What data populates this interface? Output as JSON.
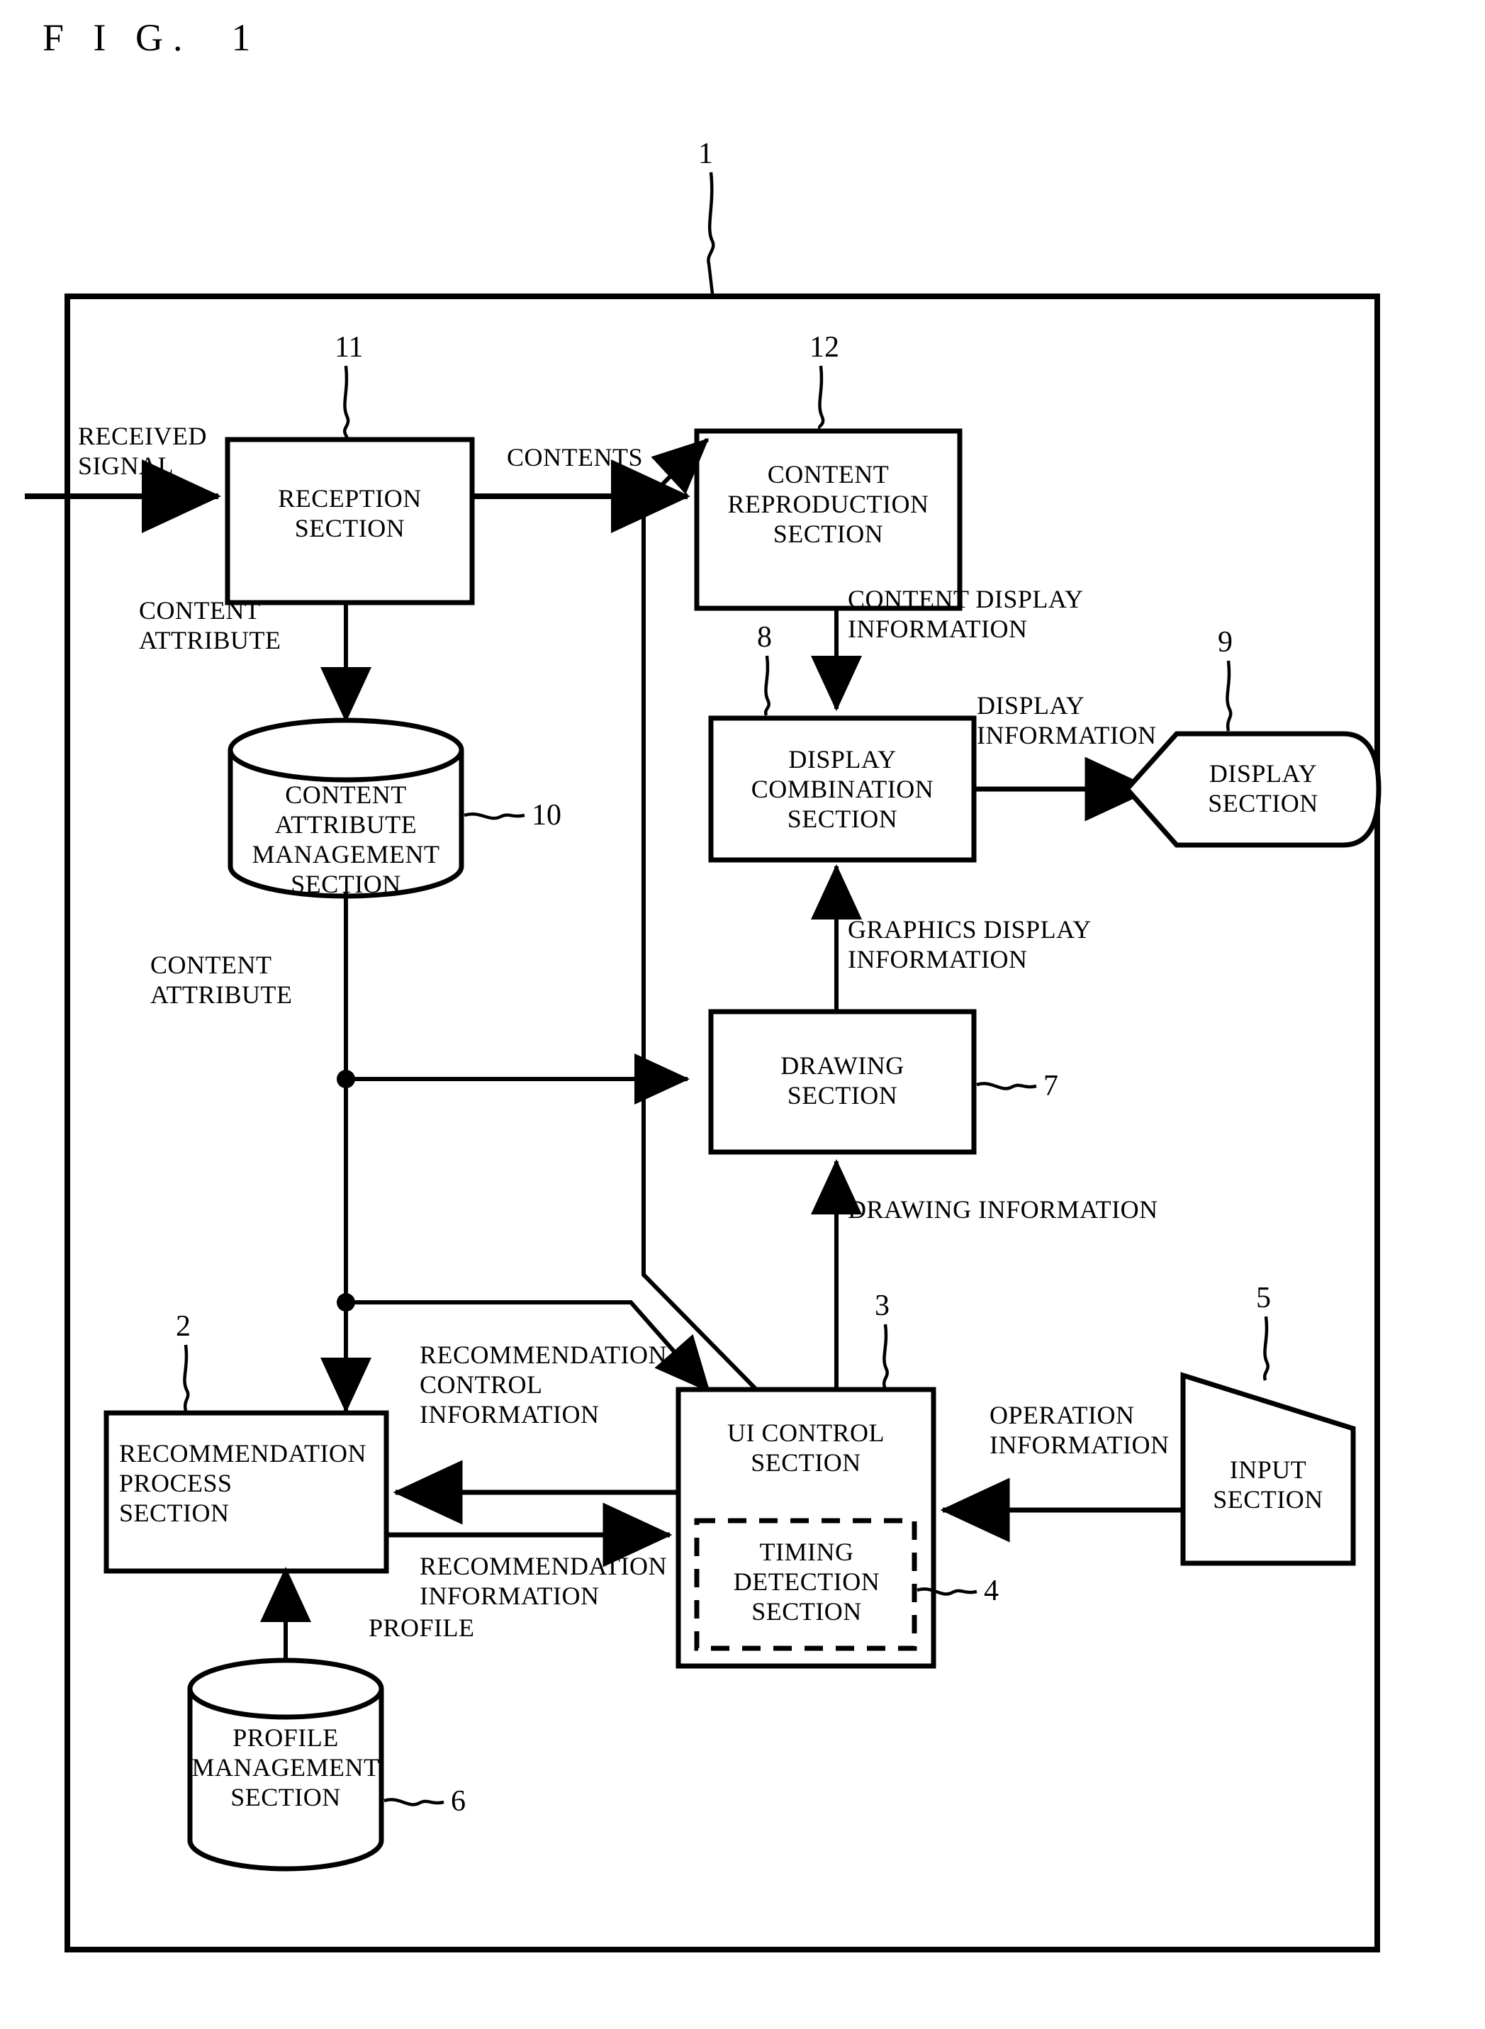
{
  "figure": {
    "title": "F I G.  1",
    "outer_ref": "1"
  },
  "blocks": {
    "reception": {
      "label": "RECEPTION\nSECTION",
      "ref": "11"
    },
    "content_reproduction": {
      "label": "CONTENT\nREPRODUCTION\nSECTION",
      "ref": "12"
    },
    "content_attribute_management": {
      "label": "CONTENT\nATTRIBUTE\nMANAGEMENT\nSECTION",
      "ref": "10"
    },
    "display_combination": {
      "label": "DISPLAY\nCOMBINATION\nSECTION",
      "ref": "8"
    },
    "display": {
      "label": "DISPLAY\nSECTION",
      "ref": "9"
    },
    "drawing": {
      "label": "DRAWING\nSECTION",
      "ref": "7"
    },
    "recommendation_process": {
      "label": "RECOMMENDATION\nPROCESS\nSECTION",
      "ref": "2"
    },
    "ui_control": {
      "label": "UI CONTROL\nSECTION",
      "ref": "3"
    },
    "timing_detection": {
      "label": "TIMING\nDETECTION\nSECTION",
      "ref": "4"
    },
    "input": {
      "label": "INPUT\nSECTION",
      "ref": "5"
    },
    "profile_management": {
      "label": "PROFILE\nMANAGEMENT\nSECTION",
      "ref": "6"
    }
  },
  "flow_labels": {
    "received_signal": "RECEIVED\nSIGNAL",
    "contents": "CONTENTS",
    "content_attribute_top": "CONTENT\nATTRIBUTE",
    "content_attribute_mid": "CONTENT\nATTRIBUTE",
    "content_display_information": "CONTENT DISPLAY\nINFORMATION",
    "display_information": "DISPLAY\nINFORMATION",
    "graphics_display_information": "GRAPHICS DISPLAY\nINFORMATION",
    "drawing_information": "DRAWING INFORMATION",
    "recommendation_control_information": "RECOMMENDATION\nCONTROL\nINFORMATION",
    "recommendation_information": "RECOMMENDATION\nINFORMATION",
    "operation_information": "OPERATION\nINFORMATION",
    "profile": "PROFILE"
  },
  "colors": {
    "ink": "#000000",
    "paper": "#ffffff"
  }
}
